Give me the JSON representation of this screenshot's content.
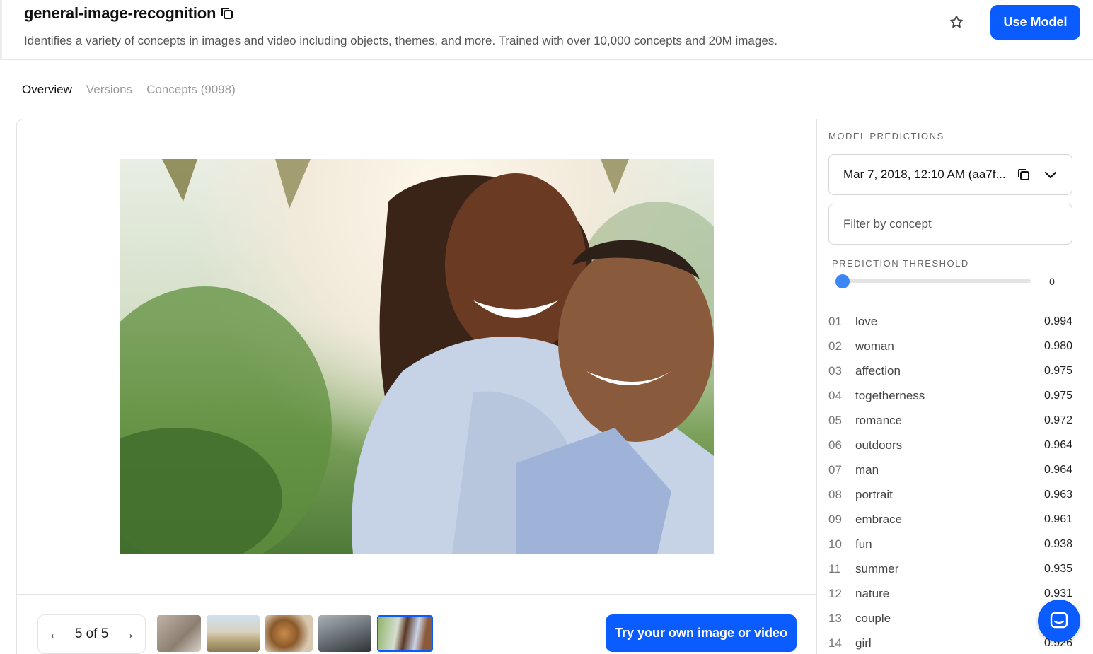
{
  "header": {
    "title": "general-image-recognition",
    "description": "Identifies a variety of concepts in images and video including objects, themes, and more. Trained with over 10,000 concepts and 20M images.",
    "use_model_label": "Use Model"
  },
  "tabs": [
    {
      "label": "Overview",
      "active": true
    },
    {
      "label": "Versions",
      "active": false
    },
    {
      "label": "Concepts (9098)",
      "active": false
    }
  ],
  "preview": {
    "pager_text": "5 of 5",
    "try_label": "Try your own image or video"
  },
  "panel": {
    "title": "MODEL PREDICTIONS",
    "version_text": "Mar 7, 2018, 12:10 AM (aa7f...",
    "filter_placeholder": "Filter by concept",
    "threshold_label": "PREDICTION THRESHOLD",
    "threshold_value": "0",
    "predictions": [
      {
        "idx": "01",
        "name": "love",
        "value": "0.994"
      },
      {
        "idx": "02",
        "name": "woman",
        "value": "0.980"
      },
      {
        "idx": "03",
        "name": "affection",
        "value": "0.975"
      },
      {
        "idx": "04",
        "name": "togetherness",
        "value": "0.975"
      },
      {
        "idx": "05",
        "name": "romance",
        "value": "0.972"
      },
      {
        "idx": "06",
        "name": "outdoors",
        "value": "0.964"
      },
      {
        "idx": "07",
        "name": "man",
        "value": "0.964"
      },
      {
        "idx": "08",
        "name": "portrait",
        "value": "0.963"
      },
      {
        "idx": "09",
        "name": "embrace",
        "value": "0.961"
      },
      {
        "idx": "10",
        "name": "fun",
        "value": "0.938"
      },
      {
        "idx": "11",
        "name": "summer",
        "value": "0.935"
      },
      {
        "idx": "12",
        "name": "nature",
        "value": "0.931"
      },
      {
        "idx": "13",
        "name": "couple",
        "value": ""
      },
      {
        "idx": "14",
        "name": "girl",
        "value": "0.926"
      }
    ]
  },
  "colors": {
    "accent": "#0a5cff",
    "slider": "#3d87f5"
  }
}
